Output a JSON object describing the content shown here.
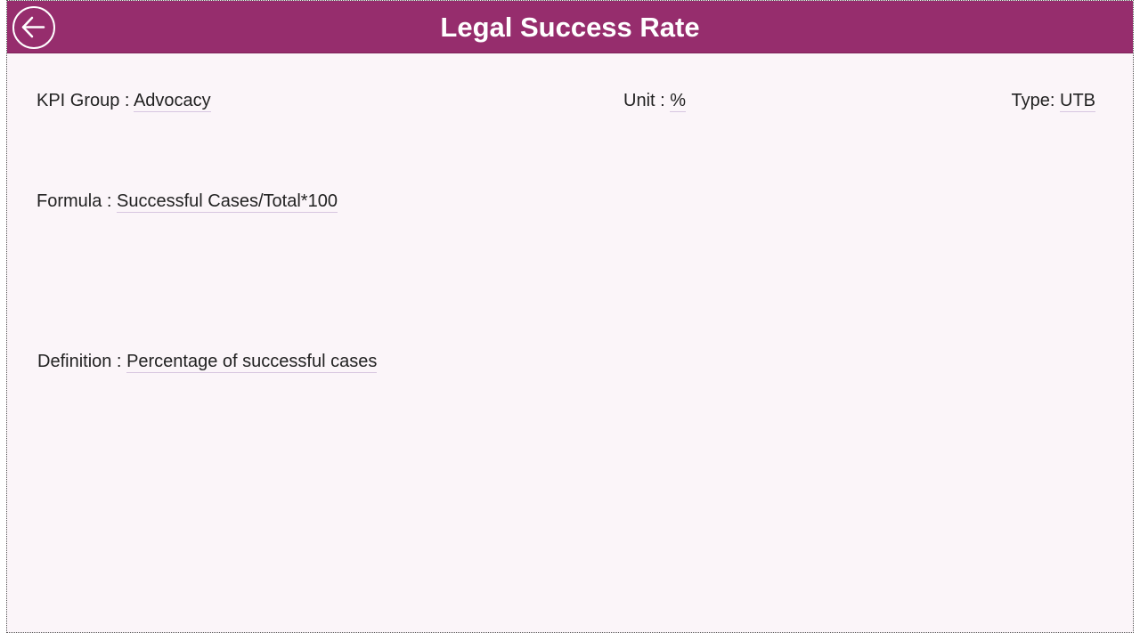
{
  "header": {
    "title": "Legal Success Rate",
    "back_icon": "arrow-left-circle-icon"
  },
  "colors": {
    "header_bg": "#962d6d",
    "page_bg": "#fbf5f9",
    "text": "#222222"
  },
  "kpi": {
    "group_label": "KPI Group : ",
    "group_value": "Advocacy",
    "unit_label": "Unit : ",
    "unit_value": "%",
    "type_label": "Type: ",
    "type_value": "UTB",
    "formula_label": "Formula : ",
    "formula_value": "Successful Cases/Total*100",
    "definition_label": "Definition : ",
    "definition_value": "Percentage of successful cases"
  }
}
